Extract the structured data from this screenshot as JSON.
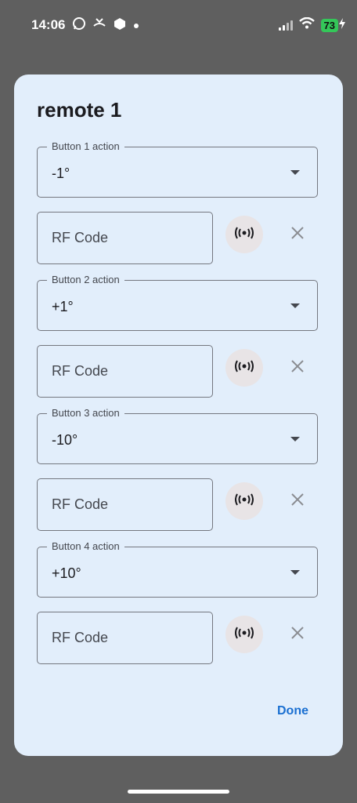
{
  "status_bar": {
    "time": "14:06",
    "battery": "73",
    "icons": [
      "whatsapp-icon",
      "missed-call-icon",
      "package-icon",
      "dot-icon",
      "signal-icon",
      "wifi-icon",
      "battery-icon",
      "charging-icon"
    ]
  },
  "dialog": {
    "title": "remote 1",
    "rows": [
      {
        "action_label": "Button 1 action",
        "action_value": "-1°",
        "rf_placeholder": "RF Code"
      },
      {
        "action_label": "Button 2 action",
        "action_value": "+1°",
        "rf_placeholder": "RF Code"
      },
      {
        "action_label": "Button 3 action",
        "action_value": "-10°",
        "rf_placeholder": "RF Code"
      },
      {
        "action_label": "Button 4 action",
        "action_value": "+10°",
        "rf_placeholder": "RF Code"
      }
    ],
    "done_label": "Done"
  },
  "colors": {
    "dialog_bg": "#e2eefb",
    "accent": "#1a6fd1",
    "scrim": "#5f5f5f"
  }
}
